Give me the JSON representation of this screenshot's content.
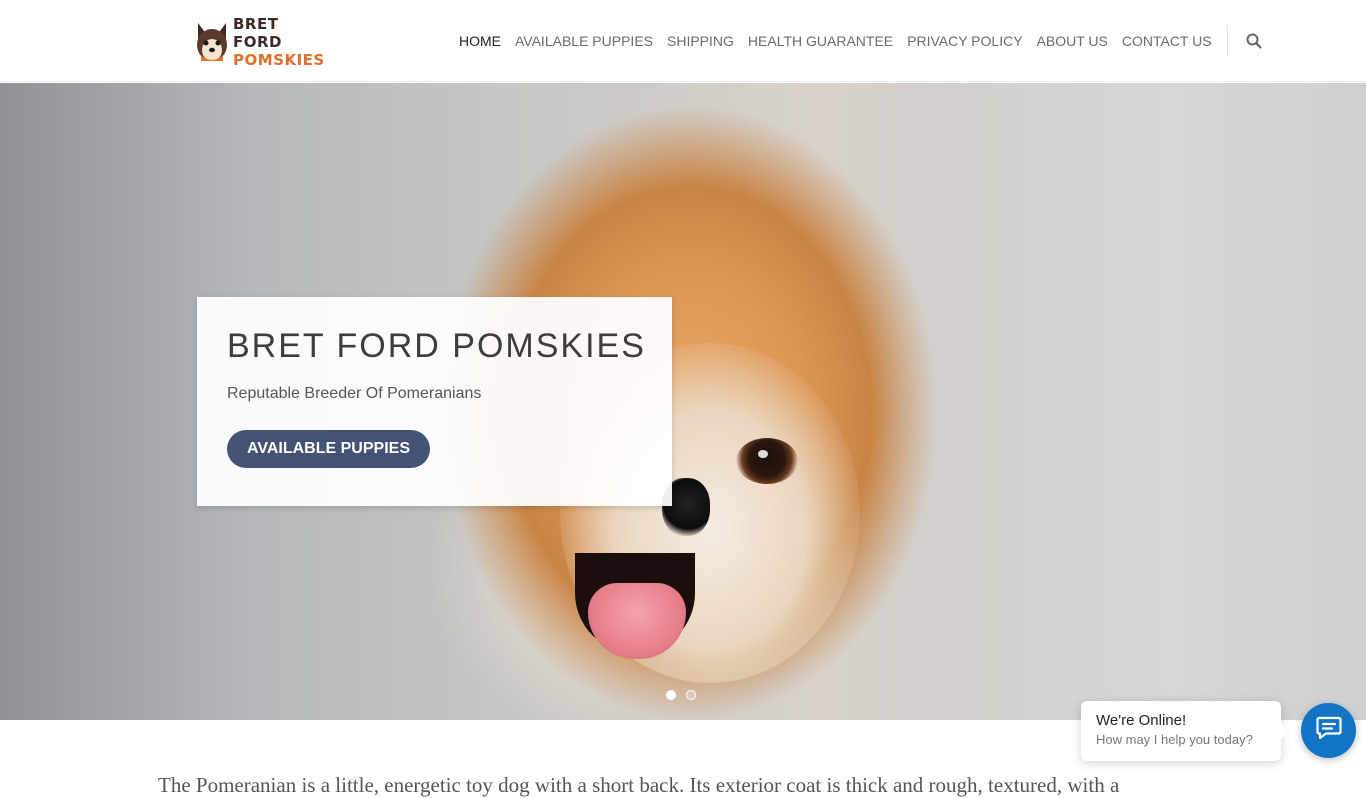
{
  "header": {
    "logo": {
      "line1": "BRET FORD",
      "line2": "POMSKIES"
    },
    "nav": [
      {
        "label": "HOME",
        "active": true
      },
      {
        "label": "AVAILABLE PUPPIES",
        "active": false
      },
      {
        "label": "SHIPPING",
        "active": false
      },
      {
        "label": "HEALTH GUARANTEE",
        "active": false
      },
      {
        "label": "PRIVACY POLICY",
        "active": false
      },
      {
        "label": "ABOUT US",
        "active": false
      },
      {
        "label": "CONTACT US",
        "active": false
      }
    ],
    "search_icon": "search-icon"
  },
  "hero": {
    "title": "BRET FORD POMSKIES",
    "subtitle": "Reputable Breeder Of Pomeranians",
    "button_label": "AVAILABLE PUPPIES",
    "slides": {
      "count": 2,
      "active_index": 0
    }
  },
  "main": {
    "intro": "The Pomeranian is a little, energetic toy dog with a short back. Its exterior coat is thick and rough, textured, with a"
  },
  "chat": {
    "title": "We're Online!",
    "subtitle": "How may I help you today?",
    "launcher_icon": "chat-icon"
  },
  "colors": {
    "button": "#445375",
    "chat_launcher": "#1274c7",
    "logo_accent": "#e0702d",
    "logo_dark": "#3b2a24"
  }
}
